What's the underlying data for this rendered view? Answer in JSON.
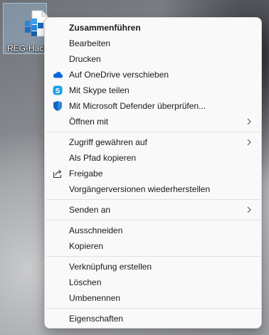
{
  "desktop": {
    "file_label": "REG-Hacks"
  },
  "menu": {
    "group1": [
      {
        "label": "Zusammenführen",
        "icon": "",
        "bold": true
      },
      {
        "label": "Bearbeiten",
        "icon": ""
      },
      {
        "label": "Drucken",
        "icon": ""
      },
      {
        "label": "Auf OneDrive verschieben",
        "icon": "onedrive-cloud-icon"
      },
      {
        "label": "Mit Skype teilen",
        "icon": "skype-icon"
      },
      {
        "label": "Mit Microsoft Defender überprüfen...",
        "icon": "defender-shield-icon"
      },
      {
        "label": "Öffnen mit",
        "icon": "",
        "submenu": true
      }
    ],
    "group2": [
      {
        "label": "Zugriff gewähren auf",
        "icon": "",
        "submenu": true
      },
      {
        "label": "Als Pfad kopieren",
        "icon": ""
      },
      {
        "label": "Freigabe",
        "icon": "share-icon"
      },
      {
        "label": "Vorgängerversionen wiederherstellen",
        "icon": ""
      }
    ],
    "group3": [
      {
        "label": "Senden an",
        "icon": "",
        "submenu": true
      }
    ],
    "group4": [
      {
        "label": "Ausschneiden",
        "icon": ""
      },
      {
        "label": "Kopieren",
        "icon": ""
      }
    ],
    "group5": [
      {
        "label": "Verknüpfung erstellen",
        "icon": ""
      },
      {
        "label": "Löschen",
        "icon": ""
      },
      {
        "label": "Umbenennen",
        "icon": ""
      }
    ],
    "group6": [
      {
        "label": "Eigenschaften",
        "icon": ""
      }
    ]
  },
  "colors": {
    "onedrive": "#0a64d8",
    "skype": "#1aa0e8",
    "defender": "#1565c0",
    "menu_bg": "#f9f9f9"
  }
}
